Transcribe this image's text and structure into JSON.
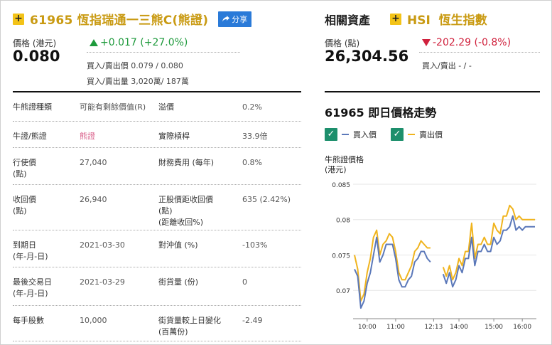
{
  "header": {
    "code": "61965",
    "name": "恆指瑞通一三熊C",
    "type_tag": "(熊證)",
    "share_label": "分享"
  },
  "price": {
    "label": "價格 (港元)",
    "value": "0.080",
    "change": "+0.017 (+27.0%)",
    "bid_ask_label": "買入/賣出價",
    "bid_ask_value": "0.079 / 0.080",
    "volume_label": "買入/賣出量",
    "volume_value": "3,020萬/ 187萬"
  },
  "related": {
    "label": "相關資產",
    "symbol": "HSI",
    "name": "恆生指數",
    "price_label": "價格 (點)",
    "price": "26,304.56",
    "change": "-202.29 (-0.8%)",
    "bid_ask": "買入/賣出 - / -"
  },
  "table": [
    {
      "k1": "牛熊證種類",
      "v1": "可能有剩餘價值(R)",
      "k2": "溢價",
      "v2": "0.2%"
    },
    {
      "k1": "牛證/熊證",
      "v1": "熊證",
      "k2": "實際槓桿",
      "v2": "33.9倍"
    },
    {
      "k1": "行使價\n(點)",
      "v1": "27,040",
      "k2": "財務費用 (每年)",
      "v2": "0.8%"
    },
    {
      "k1": "收回價\n(點)",
      "v1": "26,940",
      "k2": "正股價距收回價\n(點)\n(距離收回%)",
      "v2": "635 (2.42%)"
    },
    {
      "k1": "到期日\n(年-月-日)",
      "v1": "2021-03-30",
      "k2": "對沖值 (%)",
      "v2": "-103%"
    },
    {
      "k1": "最後交易日\n(年-月-日)",
      "v1": "2021-03-29",
      "k2": "街貨量 (份)",
      "v2": "0"
    },
    {
      "k1": "每手股數",
      "v1": "10,000",
      "k2": "街貨量較上日變化\n(百萬份)",
      "v2": "-2.49"
    }
  ],
  "chart_title": "61965 即日價格走勢",
  "legend": {
    "bid": "買入價",
    "ask": "賣出價"
  },
  "colors": {
    "bid": "#5b78b9",
    "ask": "#f0b41e",
    "accent": "#c99a12",
    "up": "#1e9a3c",
    "down": "#d0213d"
  },
  "chart_data": {
    "type": "line",
    "ylabel": "牛熊證價格\n(港元)",
    "y_ticks": [
      "0.085",
      "0.08",
      "0.075",
      "0.07"
    ],
    "x_ticks": [
      "10:00",
      "11:00",
      "12:13",
      "14:00",
      "15:00",
      "16:00"
    ],
    "ylim": [
      0.066,
      0.0855
    ],
    "series": [
      {
        "name": "買入價",
        "segments": [
          [
            [
              0,
              0.073
            ],
            [
              1,
              0.072
            ],
            [
              2,
              0.0675
            ],
            [
              3,
              0.0685
            ],
            [
              4,
              0.071
            ],
            [
              5,
              0.0725
            ],
            [
              6,
              0.075
            ],
            [
              7,
              0.0775
            ],
            [
              8,
              0.074
            ],
            [
              9,
              0.075
            ],
            [
              10,
              0.0765
            ],
            [
              11,
              0.0765
            ],
            [
              12,
              0.0765
            ],
            [
              13,
              0.0745
            ],
            [
              14,
              0.0715
            ],
            [
              15,
              0.0705
            ],
            [
              16,
              0.0705
            ],
            [
              17,
              0.0715
            ],
            [
              18,
              0.072
            ],
            [
              19,
              0.074
            ],
            [
              20,
              0.0745
            ],
            [
              21,
              0.0755
            ],
            [
              22,
              0.0755
            ],
            [
              23,
              0.0745
            ],
            [
              24,
              0.074
            ]
          ],
          [
            [
              28,
              0.0723
            ],
            [
              29,
              0.071
            ],
            [
              30,
              0.0725
            ],
            [
              31,
              0.0705
            ],
            [
              32,
              0.0715
            ],
            [
              33,
              0.0735
            ],
            [
              34,
              0.0725
            ],
            [
              35,
              0.0745
            ],
            [
              36,
              0.0745
            ],
            [
              37,
              0.0775
            ],
            [
              38,
              0.0735
            ],
            [
              39,
              0.0755
            ],
            [
              40,
              0.0755
            ],
            [
              41,
              0.0765
            ],
            [
              42,
              0.0755
            ],
            [
              43,
              0.0755
            ],
            [
              44,
              0.0775
            ],
            [
              45,
              0.0765
            ],
            [
              46,
              0.077
            ],
            [
              47,
              0.0785
            ],
            [
              48,
              0.0785
            ],
            [
              49,
              0.079
            ],
            [
              50,
              0.0805
            ],
            [
              51,
              0.0785
            ],
            [
              52,
              0.079
            ],
            [
              53,
              0.0785
            ],
            [
              54,
              0.079
            ],
            [
              55,
              0.079
            ],
            [
              56,
              0.079
            ],
            [
              57,
              0.079
            ]
          ]
        ]
      },
      {
        "name": "賣出價",
        "segments": [
          [
            [
              0,
              0.075
            ],
            [
              1,
              0.073
            ],
            [
              2,
              0.0685
            ],
            [
              3,
              0.0695
            ],
            [
              4,
              0.0725
            ],
            [
              5,
              0.0745
            ],
            [
              6,
              0.0775
            ],
            [
              7,
              0.0785
            ],
            [
              8,
              0.075
            ],
            [
              9,
              0.0765
            ],
            [
              10,
              0.077
            ],
            [
              11,
              0.078
            ],
            [
              12,
              0.0775
            ],
            [
              13,
              0.0755
            ],
            [
              14,
              0.0725
            ],
            [
              15,
              0.0715
            ],
            [
              16,
              0.0715
            ],
            [
              17,
              0.0725
            ],
            [
              18,
              0.0735
            ],
            [
              19,
              0.0755
            ],
            [
              20,
              0.076
            ],
            [
              21,
              0.077
            ],
            [
              22,
              0.0765
            ],
            [
              23,
              0.076
            ],
            [
              24,
              0.076
            ]
          ],
          [
            [
              28,
              0.0733
            ],
            [
              29,
              0.072
            ],
            [
              30,
              0.0735
            ],
            [
              31,
              0.0715
            ],
            [
              32,
              0.0725
            ],
            [
              33,
              0.0745
            ],
            [
              34,
              0.0735
            ],
            [
              35,
              0.0755
            ],
            [
              36,
              0.0755
            ],
            [
              37,
              0.0795
            ],
            [
              38,
              0.0745
            ],
            [
              39,
              0.0765
            ],
            [
              40,
              0.0765
            ],
            [
              41,
              0.0775
            ],
            [
              42,
              0.0765
            ],
            [
              43,
              0.0765
            ],
            [
              44,
              0.0795
            ],
            [
              45,
              0.0785
            ],
            [
              46,
              0.078
            ],
            [
              47,
              0.0805
            ],
            [
              48,
              0.0805
            ],
            [
              49,
              0.082
            ],
            [
              50,
              0.0815
            ],
            [
              51,
              0.08
            ],
            [
              52,
              0.0805
            ],
            [
              53,
              0.08
            ],
            [
              54,
              0.08
            ],
            [
              55,
              0.08
            ],
            [
              56,
              0.08
            ],
            [
              57,
              0.08
            ]
          ]
        ]
      }
    ],
    "x_count": 58,
    "x_tick_index": [
      4,
      13,
      25,
      33,
      44,
      53
    ]
  }
}
